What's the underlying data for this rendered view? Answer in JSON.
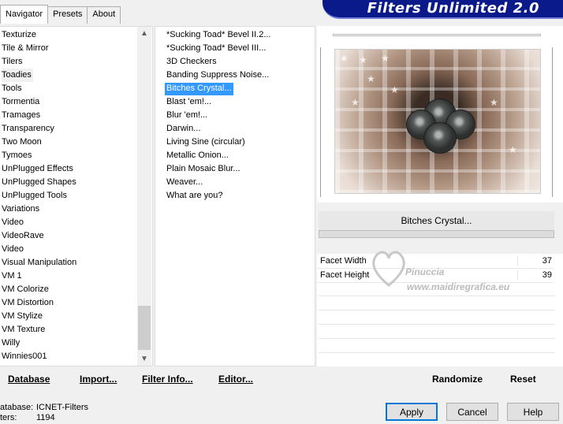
{
  "tabs": [
    "Navigator",
    "Presets",
    "About"
  ],
  "banner": {
    "title": "Filters Unlimited 2.0"
  },
  "categories": [
    "Texturize",
    "Tile & Mirror",
    "Tilers",
    "Toadies",
    "Tools",
    "Tormentia",
    "Tramages",
    "Transparency",
    "Two Moon",
    "Tymoes",
    "UnPlugged Effects",
    "UnPlugged Shapes",
    "UnPlugged Tools",
    "Variations",
    "Video",
    "VideoRave",
    "Video",
    "Visual Manipulation",
    "VM 1",
    "VM Colorize",
    "VM Distortion",
    "VM Stylize",
    "VM Texture",
    "Willy",
    "Winnies001"
  ],
  "selected_category": "Toadies",
  "filters": [
    "*Sucking Toad*  Bevel II.2...",
    "*Sucking Toad*  Bevel III...",
    "3D Checkers",
    "Banding Suppress Noise...",
    "Bitches Crystal...",
    "Blast 'em!...",
    "Blur 'em!...",
    "Darwin...",
    "Living Sine (circular)",
    "Metallic Onion...",
    "Plain Mosaic Blur...",
    "Weaver...",
    "What are you?"
  ],
  "selected_filter": "Bitches Crystal...",
  "filter_name_display": "Bitches Crystal...",
  "params": [
    {
      "label": "Facet Width",
      "value": "37"
    },
    {
      "label": "Facet Height",
      "value": "39"
    }
  ],
  "watermark": {
    "name": "Pinuccia",
    "url": "www.maidiregrafica.eu"
  },
  "toolbar": {
    "database": "Database",
    "import": "Import...",
    "filter_info": "Filter Info...",
    "editor": "Editor...",
    "randomize": "Randomize",
    "reset": "Reset"
  },
  "status": {
    "database_label": "atabase:",
    "database_value": "ICNET-Filters",
    "filters_label": "ters:",
    "filters_value": "1194"
  },
  "buttons": {
    "apply": "Apply",
    "cancel": "Cancel",
    "help": "Help"
  },
  "colors": {
    "banner": "#0a1a8a",
    "selection": "#3399ff"
  }
}
